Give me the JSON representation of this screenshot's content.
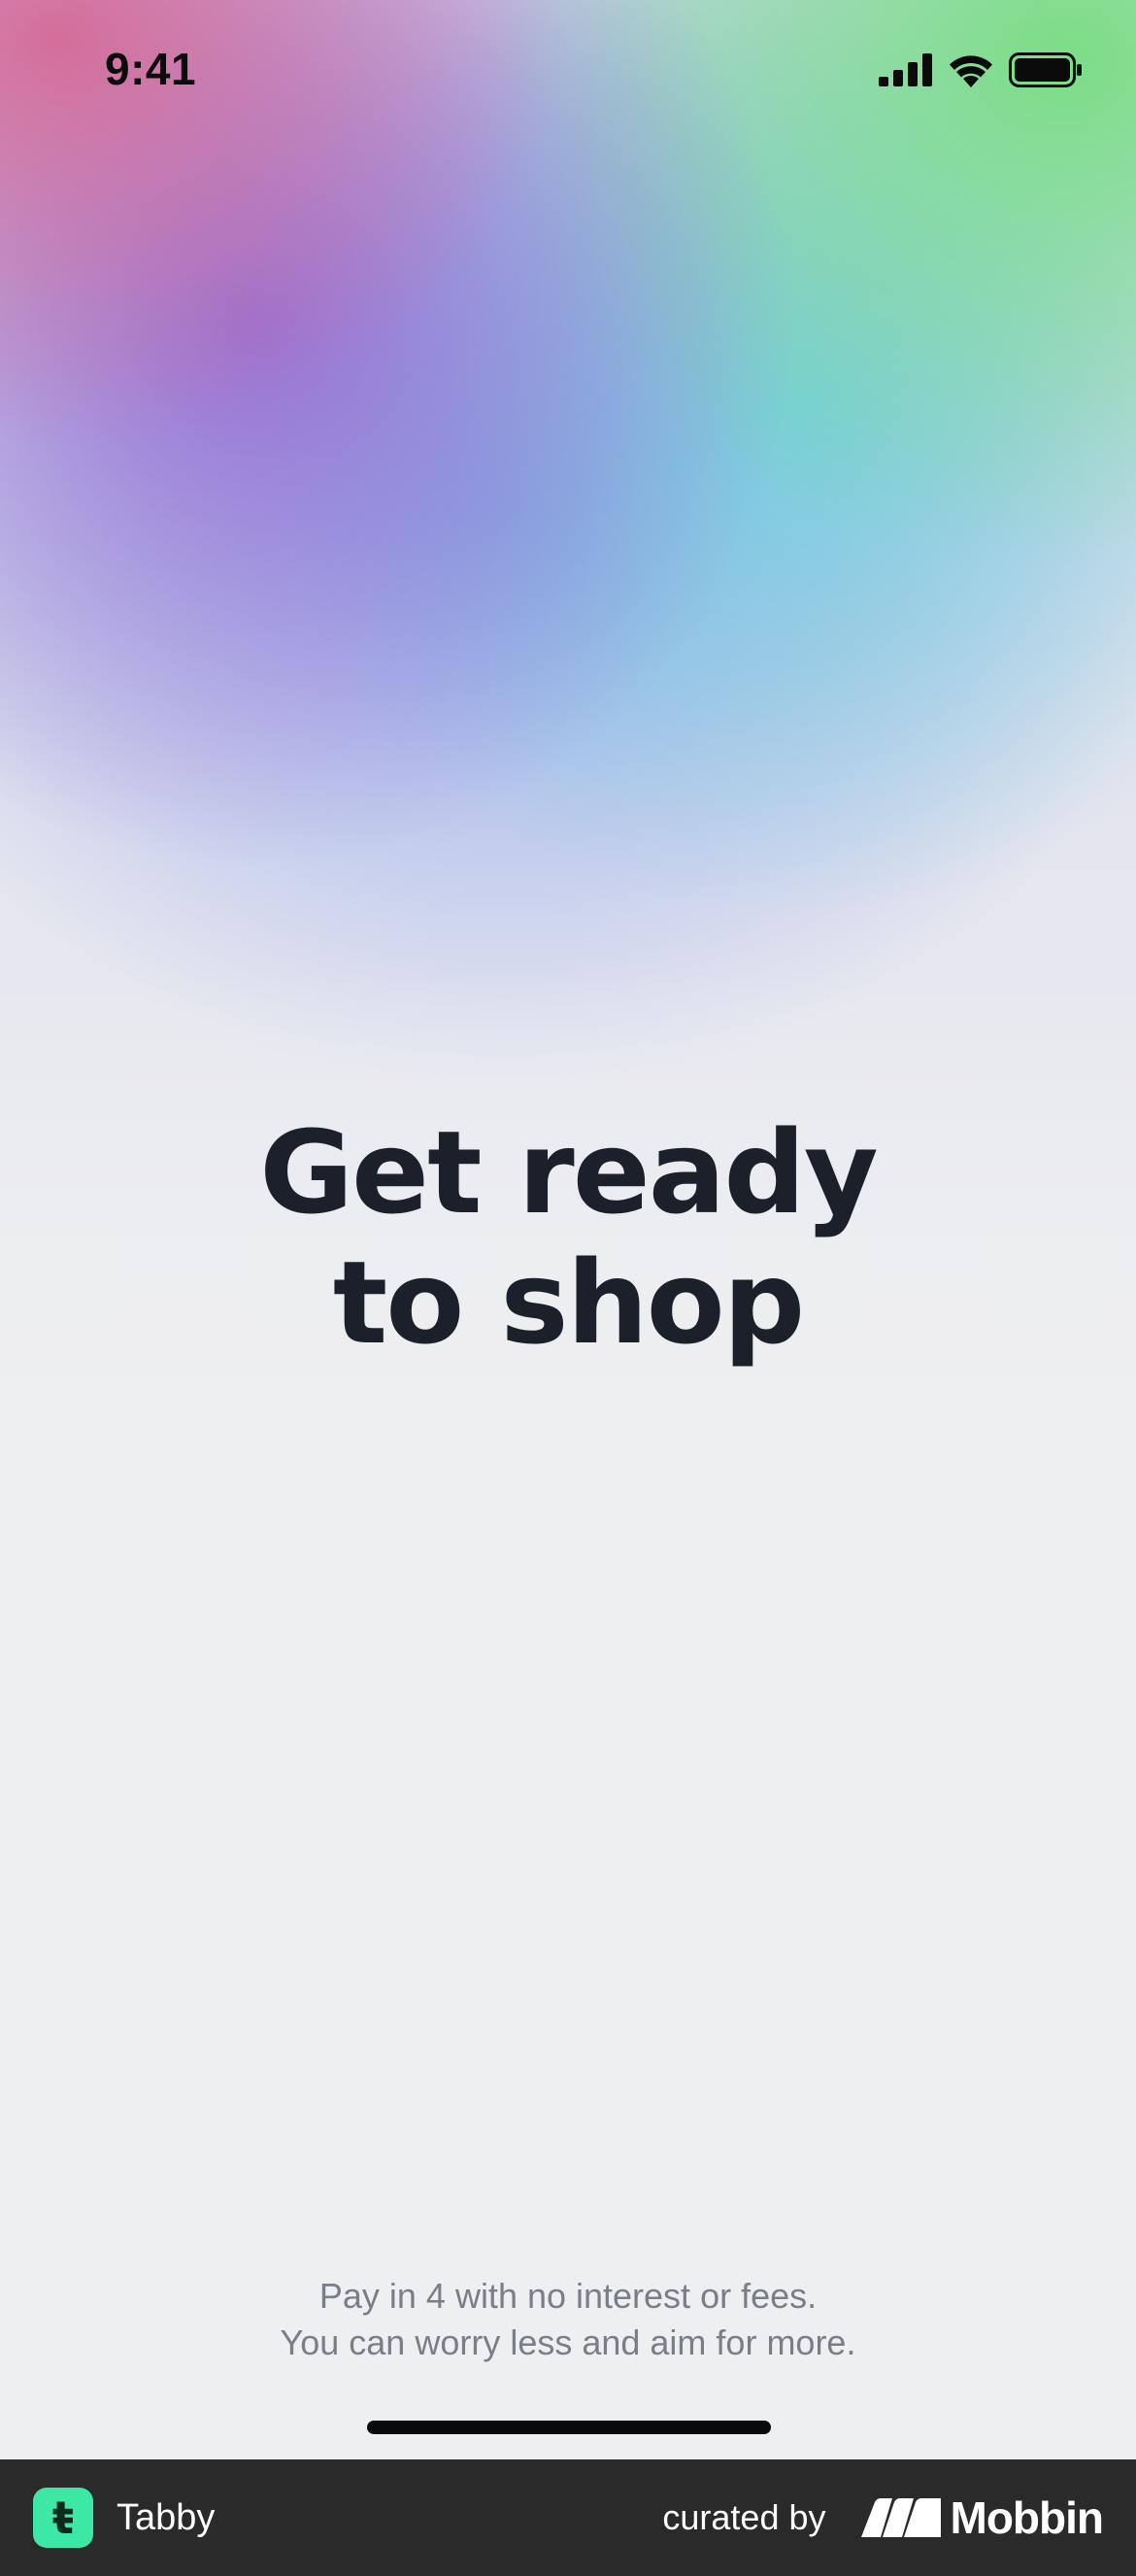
{
  "status_bar": {
    "time": "9:41",
    "icons": [
      "cellular-signal-icon",
      "wifi-icon",
      "battery-icon"
    ]
  },
  "onboarding": {
    "headline_line1": "Get ready",
    "headline_line2": "to shop",
    "subtitle_line1": "Pay in 4 with no interest or fees.",
    "subtitle_line2": "You can worry less and aim for more."
  },
  "footer": {
    "app_name": "Tabby",
    "app_icon_letter": "ŧ",
    "curated_label": "curated by",
    "brand_name": "Mobbin"
  },
  "colors": {
    "headline": "#1b202b",
    "subtitle": "#7a7e87",
    "footer_bg": "#2a2a2b",
    "app_icon_bg": "#3de8a5"
  }
}
